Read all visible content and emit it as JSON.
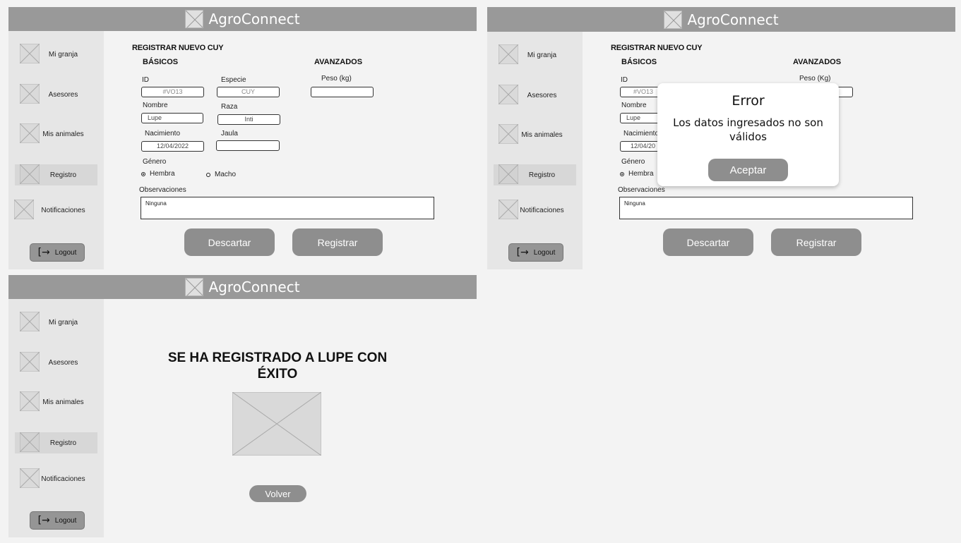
{
  "app": {
    "title": "AgroConnect"
  },
  "sidebar": {
    "items": [
      "Mi granja",
      "Asesores",
      "Mis animales",
      "Registro",
      "Notificaciones"
    ],
    "logout": "Logout"
  },
  "form": {
    "title": "REGISTRAR NUEVO CUY",
    "basic_header": "BÁSICOS",
    "advanced_header": "AVANZADOS",
    "id_label": "ID",
    "id_value": "#VO13",
    "species_label": "Especie",
    "species_value": "CUY",
    "name_label": "Nombre",
    "name_value": "Lupe",
    "breed_label": "Raza",
    "breed_value": "Inti",
    "birth_label": "Nacimiento",
    "birth_value": "12/04/2022",
    "cage_label": "Jaula",
    "cage_value": "",
    "gender_label": "Género",
    "gender_options": [
      "Hembra",
      "Macho"
    ],
    "weight_label": "Peso (kg)",
    "weight_label_alt": "Peso (Kg)",
    "weight_value": "",
    "notes_label": "Observaciones",
    "notes_value": "Ninguna",
    "discard": "Descartar",
    "register": "Registrar",
    "id_value_trunc": "#VO13",
    "birth_value_trunc": "12/04/20",
    "birth_label_trunc": "Nacimiento"
  },
  "error_modal": {
    "title": "Error",
    "message": "Los datos ingresados no son válidos",
    "accept": "Aceptar"
  },
  "success": {
    "message": "SE HA REGISTRADO A LUPE CON ÉXITO",
    "back": "Volver"
  }
}
